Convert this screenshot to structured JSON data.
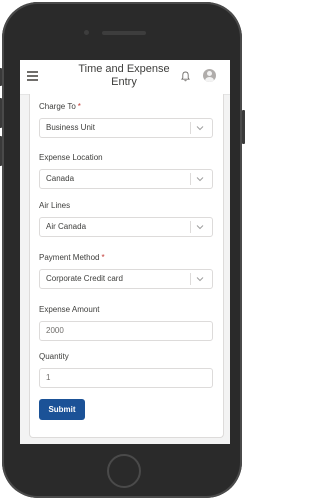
{
  "app": {
    "title": "Time and Expense Entry"
  },
  "icons": {
    "menu": "hamburger-menu-icon",
    "notifications": "bell-icon",
    "profile": "user-avatar-icon",
    "dropdown": "chevron-down-icon"
  },
  "colors": {
    "primary_button": "#1b5297",
    "required_marker": "#c23934"
  },
  "form": {
    "charge_to": {
      "label": "Charge To",
      "required": "*",
      "value": "Business Unit"
    },
    "expense_location": {
      "label": "Expense Location",
      "value": "Canada"
    },
    "air_lines": {
      "label": "Air Lines",
      "value": "Air Canada"
    },
    "payment_method": {
      "label": "Payment Method",
      "required": "*",
      "value": "Corporate Credit card"
    },
    "expense_amount": {
      "label": "Expense Amount",
      "value": "2000"
    },
    "quantity": {
      "label": "Quantity",
      "value": "1"
    },
    "submit_label": "Submit"
  }
}
